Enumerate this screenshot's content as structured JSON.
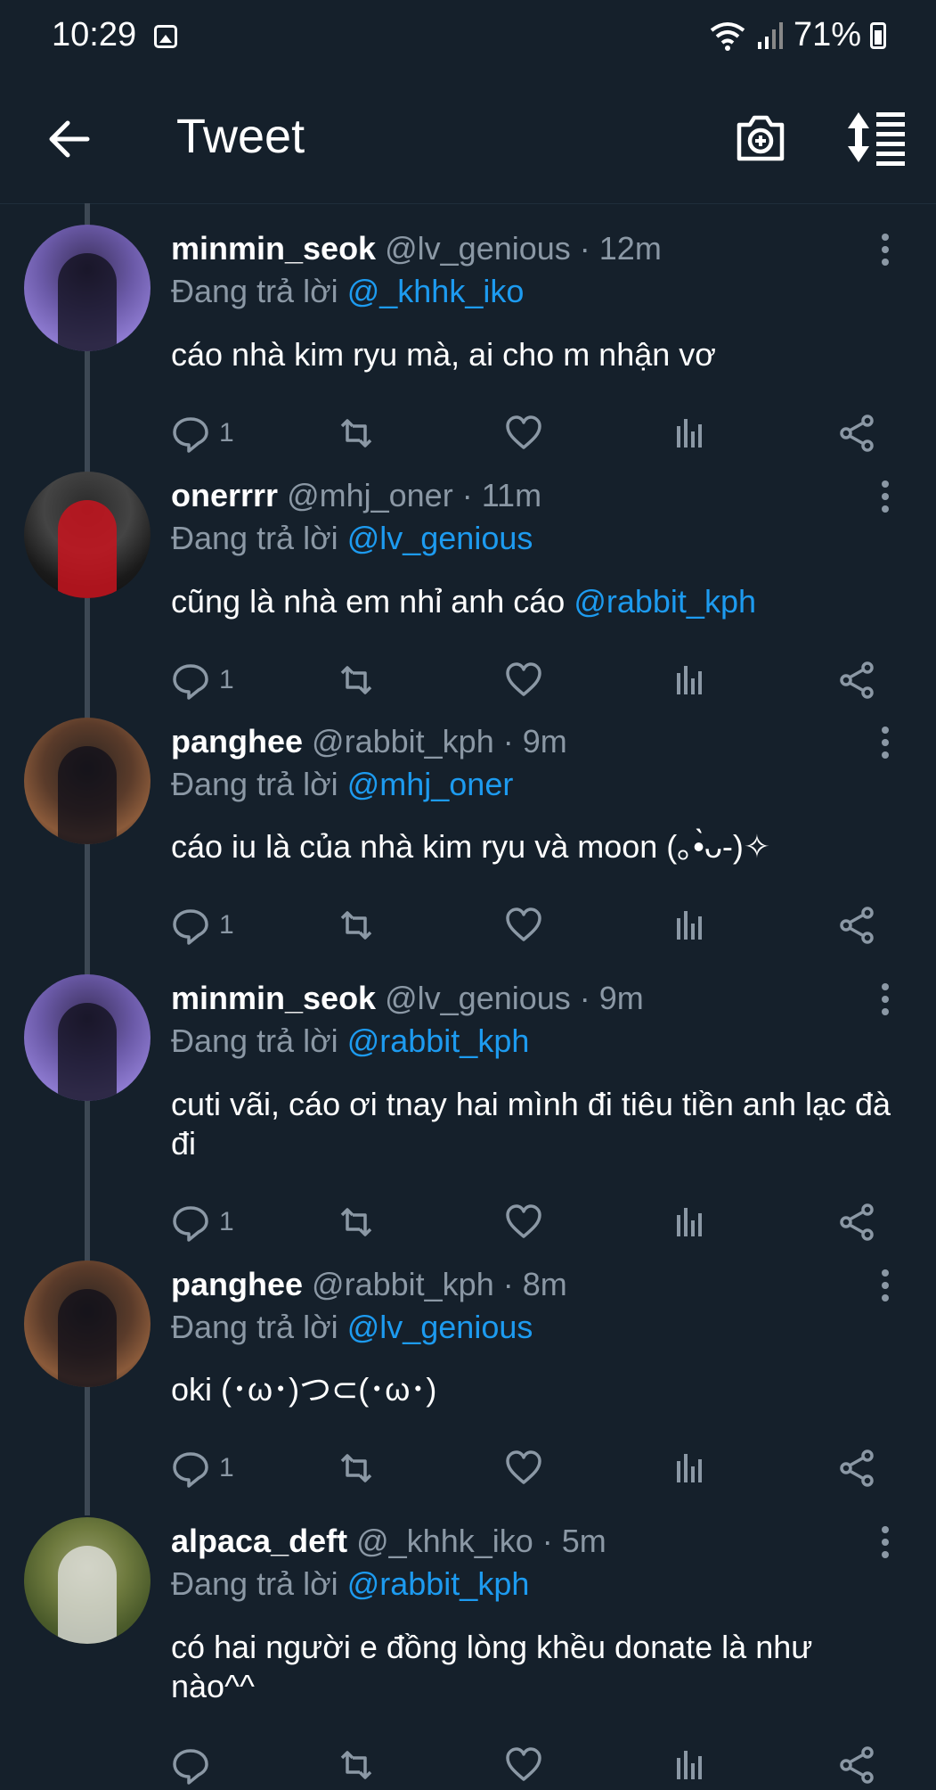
{
  "status_bar": {
    "time": "10:29",
    "battery": "71%"
  },
  "header": {
    "title": "Tweet"
  },
  "reply_prefix": "Đang trả lời",
  "tweets": [
    {
      "name": "minmin_seok",
      "handle": "@lv_genious",
      "time": "· 12m",
      "reply_to": "@_khhk_iko",
      "text": "cáo nhà kim ryu mà, ai cho m nhận vơ",
      "mention": "",
      "reply_count": "1",
      "avatar": "minmin"
    },
    {
      "name": "onerrrr",
      "handle": "@mhj_oner",
      "time": "· 11m",
      "reply_to": "@lv_genious",
      "text": "cũng là nhà em nhỉ anh cáo ",
      "mention": "@rabbit_kph",
      "reply_count": "1",
      "avatar": "onerrrr"
    },
    {
      "name": "panghee",
      "handle": "@rabbit_kph",
      "time": "· 9m",
      "reply_to": "@mhj_oner",
      "text": "cáo iu là của nhà kim ryu và moon (｡•̀ᴗ-)✧",
      "mention": "",
      "reply_count": "1",
      "avatar": "panghee"
    },
    {
      "name": "minmin_seok",
      "handle": "@lv_genious",
      "time": "· 9m",
      "reply_to": "@rabbit_kph",
      "text": "cuti vãi, cáo ơi tnay hai mình đi tiêu tiền anh lạc đà đi",
      "mention": "",
      "reply_count": "1",
      "avatar": "minmin"
    },
    {
      "name": "panghee",
      "handle": "@rabbit_kph",
      "time": "· 8m",
      "reply_to": "@lv_genious",
      "text": "oki (･ω･)つ⊂(･ω･)",
      "mention": "",
      "reply_count": "1",
      "avatar": "panghee"
    },
    {
      "name": "alpaca_deft",
      "handle": "@_khhk_iko",
      "time": "· 5m",
      "reply_to": "@rabbit_kph",
      "text": "có hai người e đồng lòng khều donate là như nào^^",
      "mention": "",
      "reply_count": "",
      "avatar": "alpaca"
    }
  ]
}
